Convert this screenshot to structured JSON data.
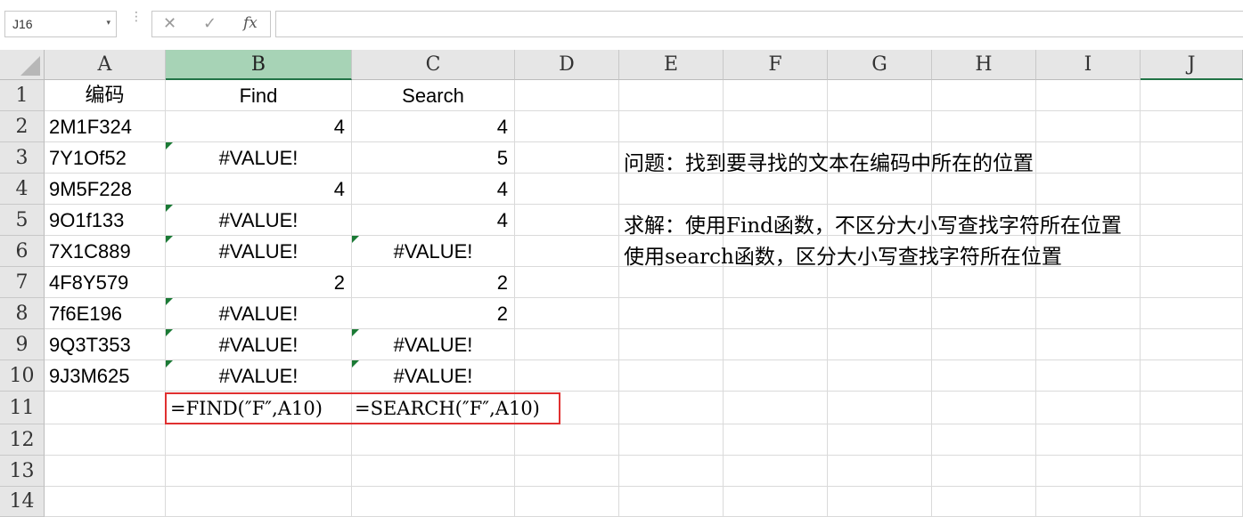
{
  "toolbar": {
    "name_box": "J16",
    "name_box_caret": "▾",
    "separator": "⋮",
    "cancel_glyph": "✕",
    "enter_glyph": "✓",
    "fx_glyph": "fx",
    "formula_value": ""
  },
  "columns": [
    {
      "id": "A",
      "label": "A"
    },
    {
      "id": "B",
      "label": "B"
    },
    {
      "id": "C",
      "label": "C"
    },
    {
      "id": "D",
      "label": "D"
    },
    {
      "id": "E",
      "label": "E"
    },
    {
      "id": "F",
      "label": "F"
    },
    {
      "id": "G",
      "label": "G"
    },
    {
      "id": "H",
      "label": "H"
    },
    {
      "id": "I",
      "label": "I"
    },
    {
      "id": "J",
      "label": "J"
    }
  ],
  "rows": [
    "1",
    "2",
    "3",
    "4",
    "5",
    "6",
    "7",
    "8",
    "9",
    "10",
    "11",
    "12",
    "13",
    "14"
  ],
  "table": {
    "headers": {
      "a": "编码",
      "b": "Find",
      "c": "Search"
    },
    "data": [
      {
        "a": "2M1F324",
        "b": "4",
        "c": "4"
      },
      {
        "a": "7Y1Of52",
        "b": "#VALUE!",
        "c": "5"
      },
      {
        "a": "9M5F228",
        "b": "4",
        "c": "4"
      },
      {
        "a": "9O1f133",
        "b": "#VALUE!",
        "c": "4"
      },
      {
        "a": "7X1C889",
        "b": "#VALUE!",
        "c": "#VALUE!"
      },
      {
        "a": "4F8Y579",
        "b": "2",
        "c": "2"
      },
      {
        "a": "7f6E196",
        "b": "#VALUE!",
        "c": "2"
      },
      {
        "a": "9Q3T353",
        "b": "#VALUE!",
        "c": "#VALUE!"
      },
      {
        "a": "9J3M625",
        "b": "#VALUE!",
        "c": "#VALUE!"
      }
    ]
  },
  "formulas": {
    "find": "=FIND(″F″,A10)",
    "search": "=SEARCH(″F″,A10)"
  },
  "notes": {
    "question": "问题：找到要寻找的文本在编码中所在的位置",
    "solution1": "求解：使用Find函数，不区分大小写查找字符所在位置",
    "solution2": "使用search函数，区分大小写查找字符所在位置"
  },
  "colors": {
    "header_bg": "#e6e6e6",
    "selected_col_bg": "#a7d3b6",
    "accent": "#217346",
    "error_marker": "#1b7a35",
    "highlight_border": "#e03030"
  }
}
